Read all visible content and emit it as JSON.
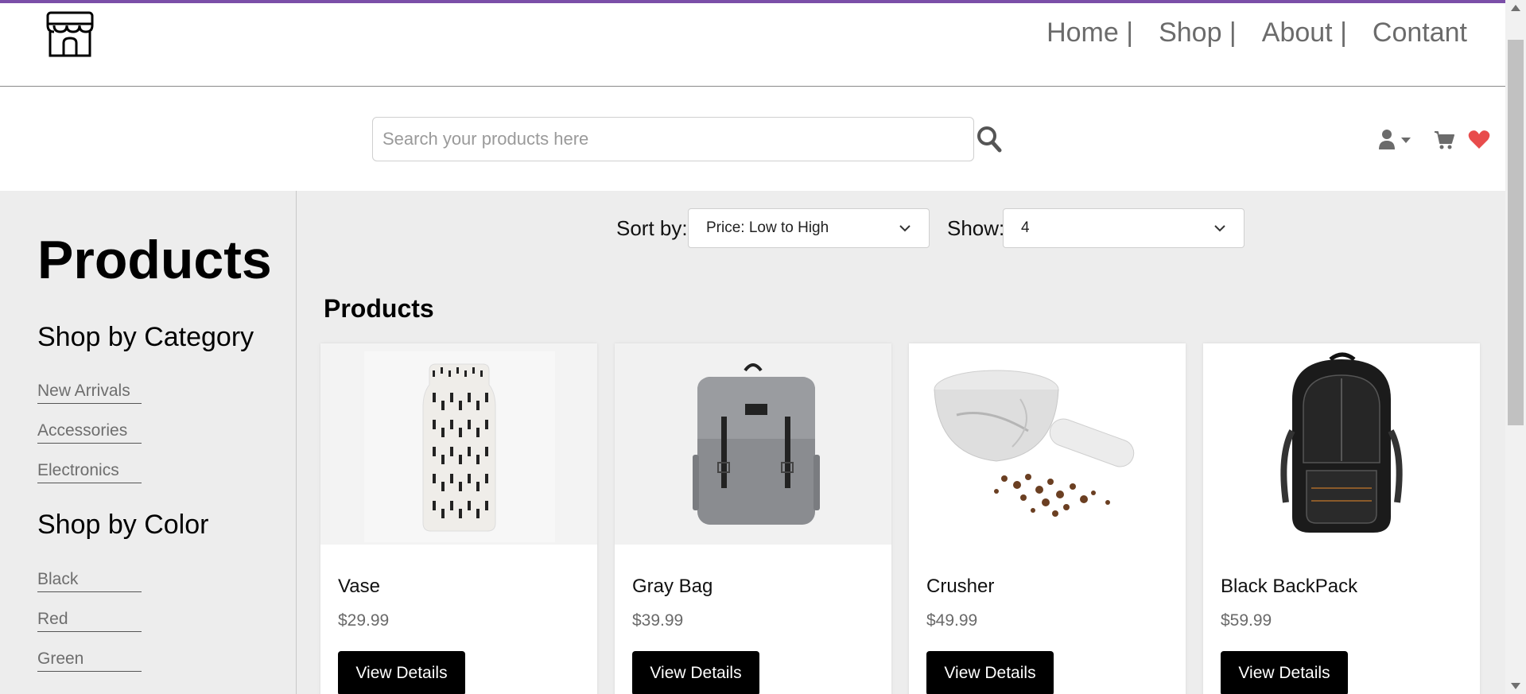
{
  "header": {
    "nav": [
      {
        "label": "Home |"
      },
      {
        "label": "Shop |"
      },
      {
        "label": "About |"
      },
      {
        "label": "Contant"
      }
    ]
  },
  "search": {
    "placeholder": "Search your products here",
    "value": ""
  },
  "sidebar": {
    "title": "Products",
    "category_heading": "Shop by Category",
    "categories": [
      {
        "label": "New Arrivals"
      },
      {
        "label": "Accessories"
      },
      {
        "label": "Electronics"
      }
    ],
    "color_heading": "Shop by Color",
    "colors": [
      {
        "label": "Black"
      },
      {
        "label": "Red"
      },
      {
        "label": "Green"
      }
    ]
  },
  "controls": {
    "sort_label": "Sort by:",
    "sort_value": "Price: Low to High",
    "show_label": "Show:",
    "show_value": "4"
  },
  "products_heading": "Products",
  "products": [
    {
      "name": "Vase",
      "price": "$29.99",
      "button": "View Details"
    },
    {
      "name": "Gray Bag",
      "price": "$39.99",
      "button": "View Details"
    },
    {
      "name": "Crusher",
      "price": "$49.99",
      "button": "View Details"
    },
    {
      "name": "Black BackPack",
      "price": "$59.99",
      "button": "View Details"
    }
  ],
  "colors": {
    "accent_bar": "#7b4fa8",
    "heart": "#e84c4c",
    "button_bg": "#000000",
    "main_bg": "#ededed"
  },
  "icons": [
    "store-logo-icon",
    "search-icon",
    "user-icon",
    "caret-down-icon",
    "cart-icon",
    "heart-icon",
    "chevron-down-icon"
  ]
}
